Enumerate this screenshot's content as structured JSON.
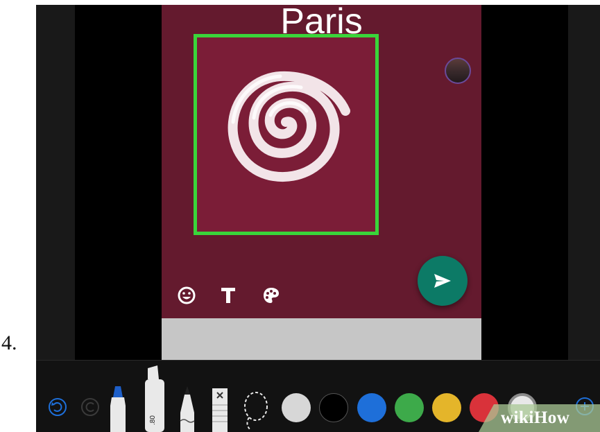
{
  "step_label": "4.",
  "card": {
    "title": "Paris",
    "background_color": "#641a2e",
    "highlight_color": "#3ad53a"
  },
  "card_tools": [
    "smiley-icon",
    "text-tool-icon",
    "palette-icon"
  ],
  "send_button": {
    "icon": "send-arrow-icon",
    "color": "#0c7a66"
  },
  "toolbar": {
    "actions": [
      "undo-icon",
      "redo-icon"
    ],
    "tools": [
      "pen-tool",
      "marker-tool",
      "pencil-tool",
      "eraser-tool",
      "lasso-tool"
    ],
    "marker_label": ".80",
    "colors": [
      "#d7d7d7",
      "#000000",
      "#1e6fd9",
      "#3daa4a",
      "#e4b52a",
      "#d9323a",
      "#e8e8e8"
    ],
    "add_icon": "add-icon"
  },
  "watermark": {
    "text": "wikiHow"
  }
}
